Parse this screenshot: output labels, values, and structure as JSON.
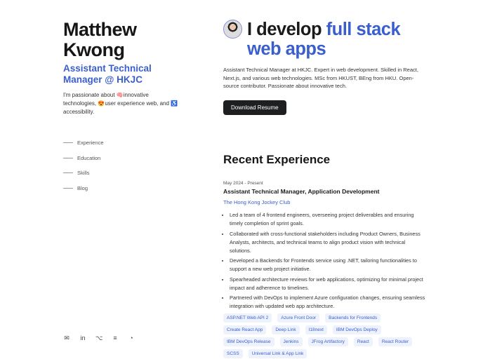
{
  "profile": {
    "name": "Matthew Kwong",
    "role": "Assistant Technical Manager @ HKJC",
    "intro": "I'm passionate about 🧠innovative technologies, 😍user experience web, and ♿ accessibility."
  },
  "nav": [
    {
      "label": "Experience"
    },
    {
      "label": "Education"
    },
    {
      "label": "Skills"
    },
    {
      "label": "Blog"
    }
  ],
  "social": [
    {
      "icon": "mail-icon",
      "glyph": "✉"
    },
    {
      "icon": "linkedin-icon",
      "glyph": "in"
    },
    {
      "icon": "github-icon",
      "glyph": "⌥"
    },
    {
      "icon": "stackoverflow-icon",
      "glyph": "≡"
    },
    {
      "icon": "rss-icon",
      "glyph": "◔"
    }
  ],
  "hero": {
    "heading_plain": "I develop ",
    "heading_accent": "full stack web apps",
    "bio": "Assistant Technical Manager at HKJC. Expert in web development. Skilled in React, Next.js, and various web technologies. MSc from HKUST, BEng from HKU. Open-source contributor. Passionate about innovative tech.",
    "button": "Download Resume"
  },
  "experience": {
    "heading": "Recent Experience",
    "date": "May 2024 - Present",
    "title": "Assistant Technical Manager, Application Development",
    "company": "The Hong Kong Jockey Club",
    "bullets": [
      "Led a team of 4 frontend engineers, overseeing project deliverables and ensuring timely completion of sprint goals.",
      "Collaborated with cross-functional stakeholders including Product Owners, Business Analysts, architects, and technical teams to align product vision with technical solutions.",
      "Developed a Backends for Frontends service using .NET, tailoring functionalities to support a new web project initiative.",
      "Spearheaded architecture reviews for web applications, optimizing for minimal project impact and adherence to timelines.",
      "Partnered with DevOps to implement Azure configuration changes, ensuring seamless integration with updated web app architecture."
    ],
    "tags": [
      "ASP.NET Web API 2",
      "Azure Front Door",
      "Backends for Frontends",
      "Create React App",
      "Deep Link",
      "I18next",
      "IBM DevOps Deploy",
      "IBM DevOps Release",
      "Jenkins",
      "JFrog Artifactory",
      "React",
      "React Router",
      "SCSS",
      "Universal Link & App Link"
    ]
  },
  "colors": {
    "accent": "#3a5fcd",
    "button": "#1e1f21",
    "tag_bg": "#eef2fc"
  }
}
